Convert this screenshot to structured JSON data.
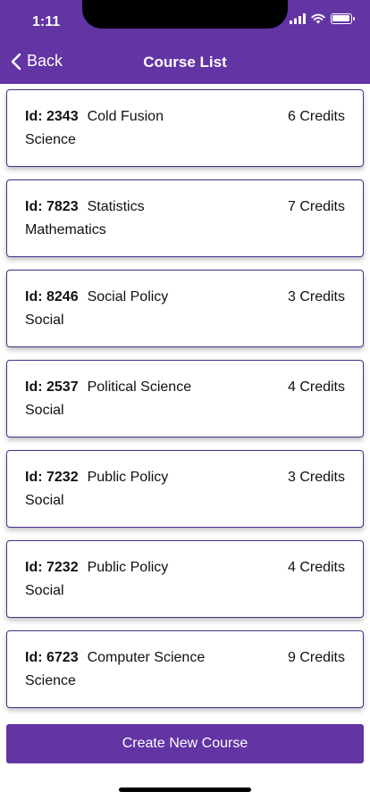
{
  "status_bar": {
    "time": "1:11"
  },
  "nav": {
    "back_label": "Back",
    "title": "Course List"
  },
  "courses": [
    {
      "id_label": "Id: 2343",
      "name": "Cold Fusion",
      "credits": "6 Credits",
      "department": "Science"
    },
    {
      "id_label": "Id: 7823",
      "name": "Statistics",
      "credits": "7 Credits",
      "department": "Mathematics"
    },
    {
      "id_label": "Id: 8246",
      "name": "Social Policy",
      "credits": "3 Credits",
      "department": "Social"
    },
    {
      "id_label": "Id: 2537",
      "name": "Political Science",
      "credits": "4 Credits",
      "department": "Social"
    },
    {
      "id_label": "Id: 7232",
      "name": "Public Policy",
      "credits": "3 Credits",
      "department": "Social"
    },
    {
      "id_label": "Id: 7232",
      "name": "Public Policy",
      "credits": "4 Credits",
      "department": "Social"
    },
    {
      "id_label": "Id: 6723",
      "name": "Computer Science",
      "credits": "9 Credits",
      "department": "Science"
    }
  ],
  "actions": {
    "create_label": "Create New Course"
  },
  "theme": {
    "primary": "#6234a4",
    "card_border": "#4a2c86"
  }
}
